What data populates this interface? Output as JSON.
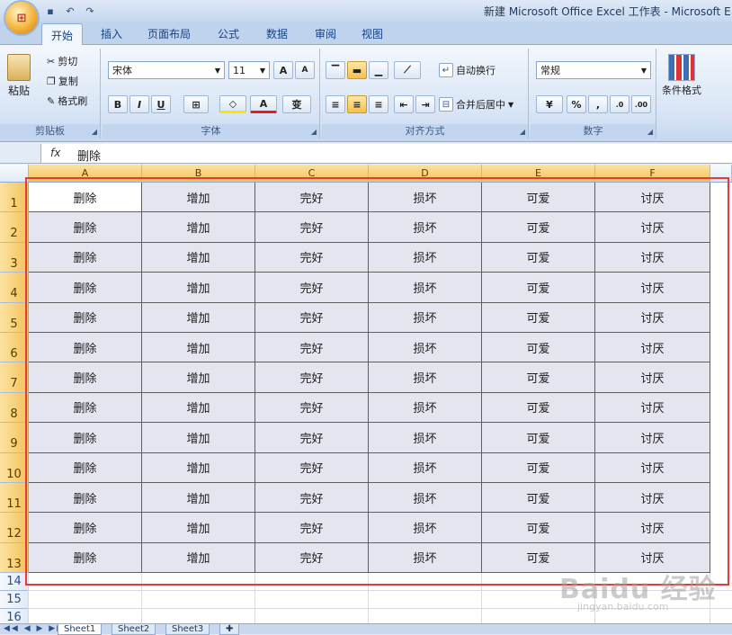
{
  "window": {
    "title": "新建 Microsoft Office Excel 工作表 - Microsoft E"
  },
  "office_button": {
    "label": "Office"
  },
  "ribbon_tabs": [
    {
      "label": "开始",
      "active": true
    },
    {
      "label": "插入"
    },
    {
      "label": "页面布局"
    },
    {
      "label": "公式"
    },
    {
      "label": "数据"
    },
    {
      "label": "审阅"
    },
    {
      "label": "视图"
    }
  ],
  "clipboard": {
    "paste": "粘贴",
    "cut": "剪切",
    "copy": "复制",
    "format_painter": "格式刷",
    "group": "剪贴板"
  },
  "font": {
    "name": "宋体",
    "size": "11",
    "grow": "A",
    "shrink": "A",
    "bold": "B",
    "italic": "I",
    "underline": "U",
    "border": "⊞",
    "fill": "◇",
    "color": "A",
    "phonetic": "变",
    "group": "字体"
  },
  "alignment": {
    "wrap": "自动换行",
    "merge": "合并后居中",
    "group": "对齐方式"
  },
  "number": {
    "format": "常规",
    "percent": "%",
    "comma": ",",
    "group": "数字",
    "currency": "¥"
  },
  "styles": {
    "conditional": "条件格式"
  },
  "formula_bar": {
    "fx": "fx",
    "content": "删除"
  },
  "columns": [
    "A",
    "B",
    "C",
    "D",
    "E",
    "F"
  ],
  "rows": [
    "1",
    "2",
    "3",
    "4",
    "5",
    "6",
    "7",
    "8",
    "9",
    "10",
    "11",
    "12",
    "13",
    "14",
    "15",
    "16"
  ],
  "row_values": [
    "删除",
    "增加",
    "完好",
    "损坏",
    "可爱",
    "讨厌"
  ],
  "sheet_tabs": [
    "Sheet1",
    "Sheet2",
    "Sheet3"
  ],
  "watermark": {
    "brand": "Baidu 经验",
    "url": "jingyan.baidu.com"
  },
  "colors": {
    "highlight": "#e23b3b",
    "selection_fill": "#e5e5ef",
    "header_selected": "#f4c25b"
  }
}
